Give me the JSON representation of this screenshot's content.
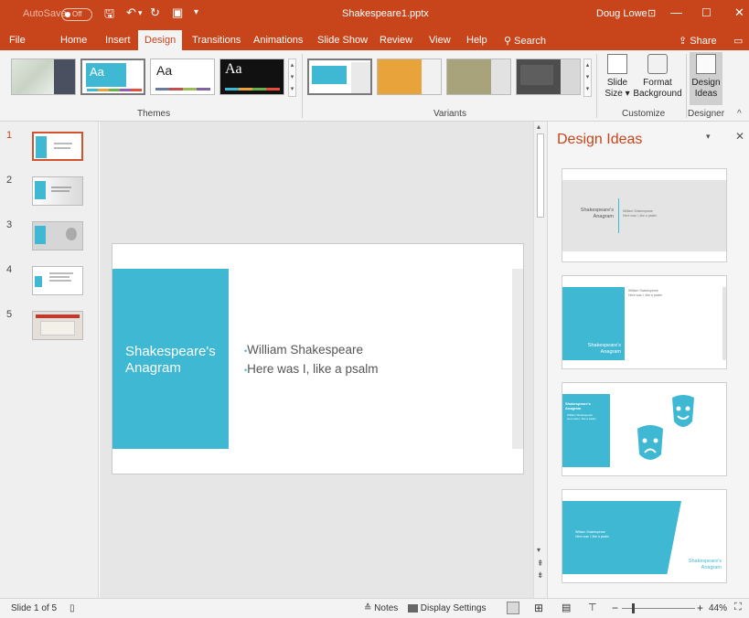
{
  "titlebar": {
    "autosave": "AutoSave",
    "autosave_state": "Off",
    "filename": "Shakespeare1.pptx",
    "user": "Doug Lowe"
  },
  "tabs": [
    "File",
    "Home",
    "Insert",
    "Design",
    "Transitions",
    "Animations",
    "Slide Show",
    "Review",
    "View",
    "Help"
  ],
  "search_label": "Search",
  "share_label": "Share",
  "ribbon": {
    "theme_glyph": "Aa",
    "themes_label": "Themes",
    "variants_label": "Variants",
    "customize_label": "Customize",
    "designer_label": "Designer",
    "slide_size_line1": "Slide",
    "slide_size_line2": "Size ▾",
    "format_bg_line1": "Format",
    "format_bg_line2": "Background",
    "design_ideas_line1": "Design",
    "design_ideas_line2": "Ideas"
  },
  "slides_panel": {
    "numbers": [
      "1",
      "2",
      "3",
      "4",
      "5"
    ]
  },
  "slide": {
    "title_line1": "Shakespeare's",
    "title_line2": "Anagram",
    "bullet1": "William Shakespeare",
    "bullet2": "Here was I, like a psalm",
    "accent_color": "#3fb8d4"
  },
  "design_pane": {
    "title": "Design Ideas",
    "idea_title_line1": "Shakespeare's",
    "idea_title_line2": "Anagram",
    "idea_bullet1": "William Shakespeare",
    "idea_bullet2": "Here was I, like a psalm"
  },
  "statusbar": {
    "slide_info": "Slide 1 of 5",
    "notes": "Notes",
    "display_settings": "Display Settings",
    "zoom": "44%"
  }
}
